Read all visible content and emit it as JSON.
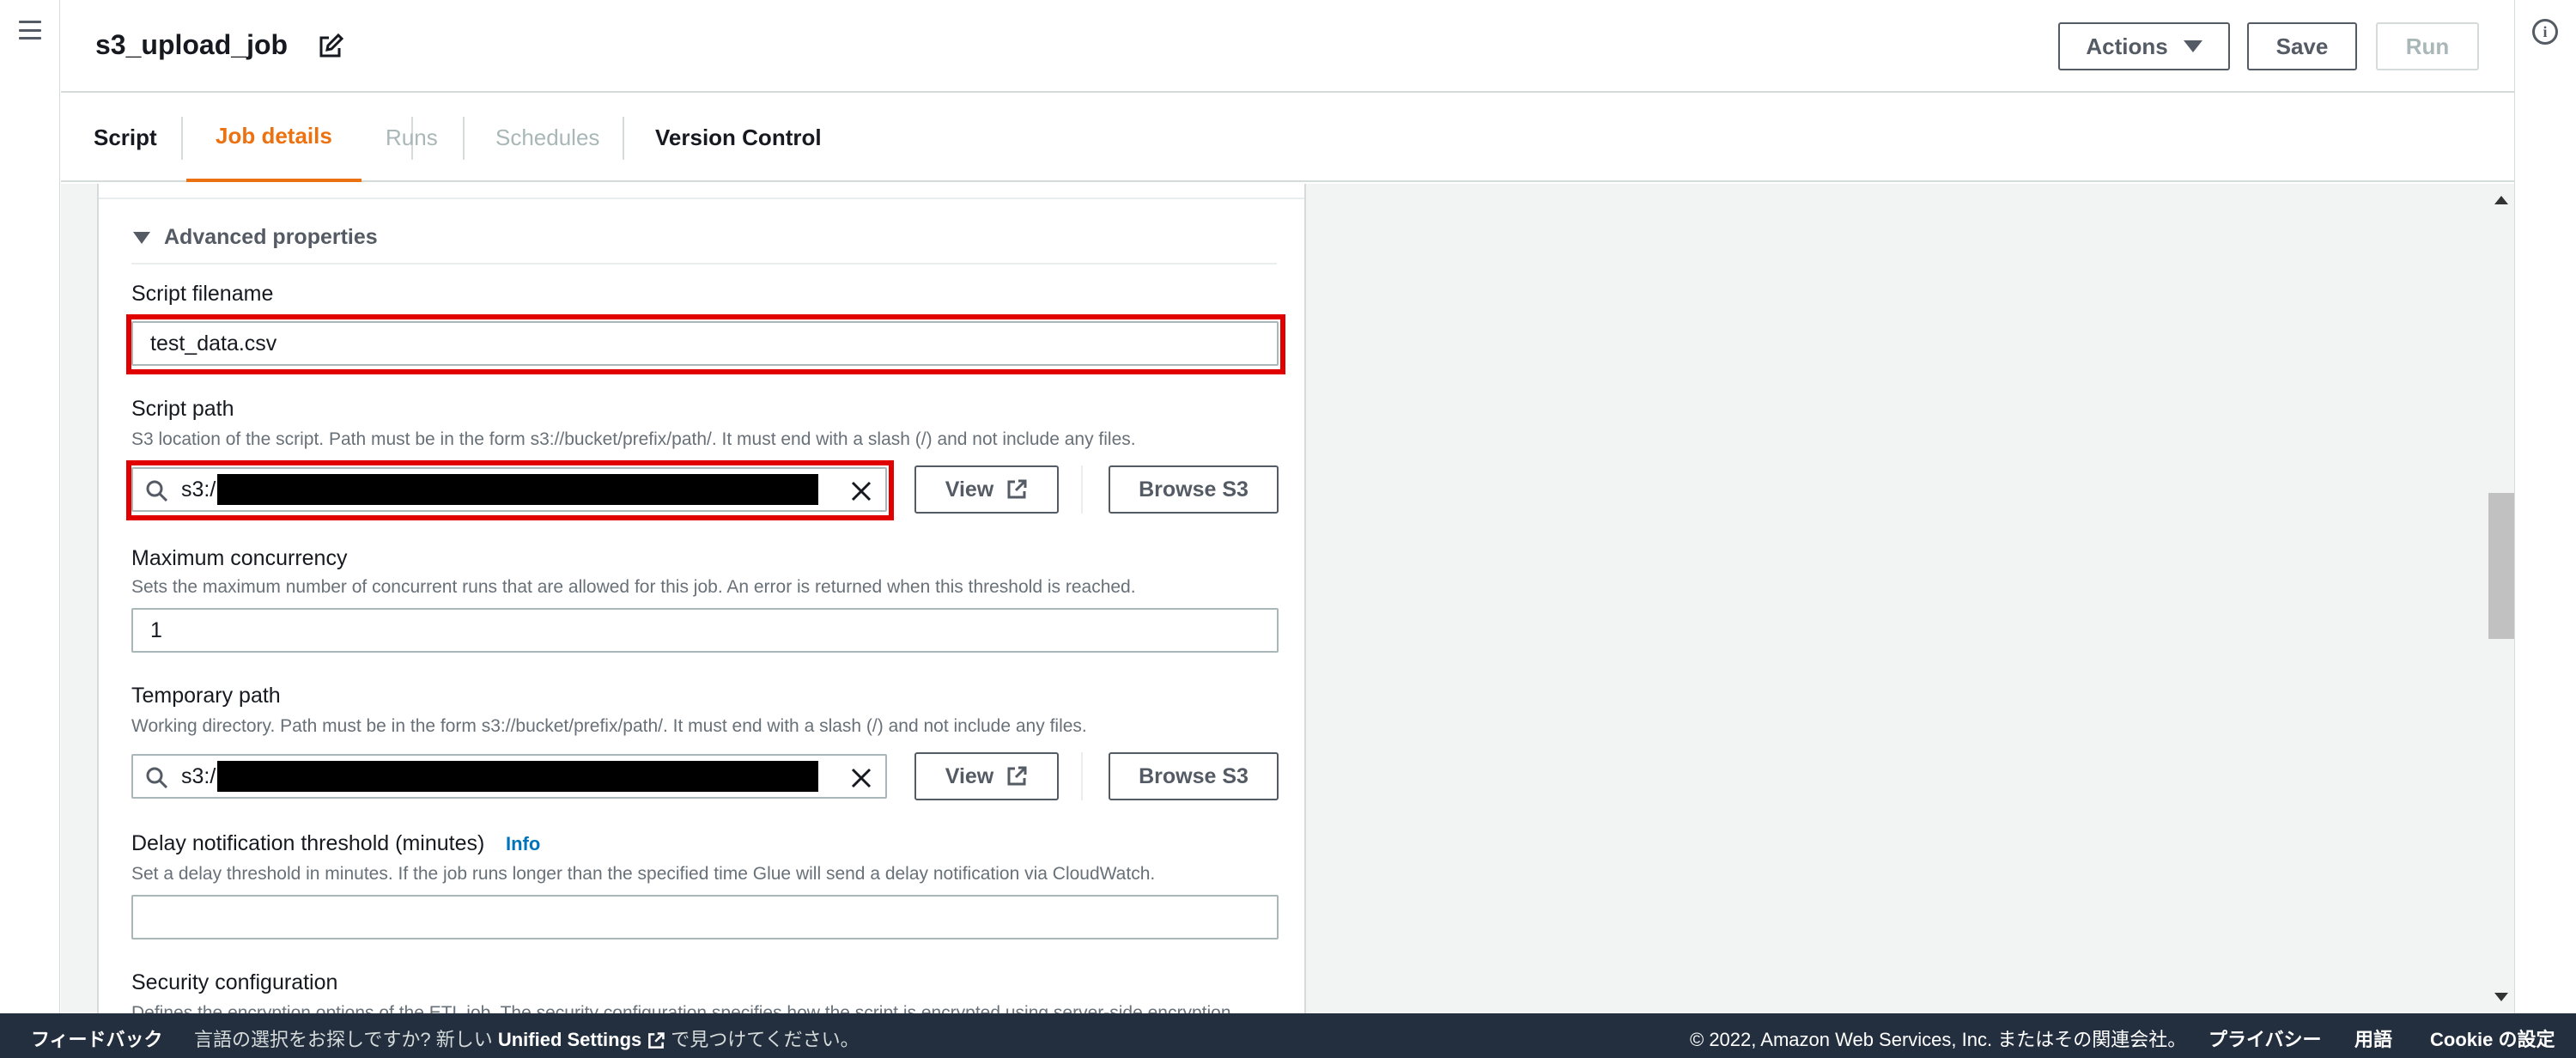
{
  "header": {
    "title": "s3_upload_job",
    "actions_label": "Actions",
    "save_label": "Save",
    "run_label": "Run"
  },
  "tabs": [
    {
      "label": "Script",
      "state": "normal"
    },
    {
      "label": "Job details",
      "state": "active"
    },
    {
      "label": "Runs",
      "state": "disabled"
    },
    {
      "label": "Schedules",
      "state": "disabled"
    },
    {
      "label": "Version Control",
      "state": "normal"
    }
  ],
  "advanced": {
    "header": "Advanced properties",
    "script_filename": {
      "label": "Script filename",
      "value": "test_data.csv"
    },
    "script_path": {
      "label": "Script path",
      "description": "S3 location of the script. Path must be in the form s3://bucket/prefix/path/. It must end with a slash (/) and not include any files.",
      "value": "s3:/",
      "view_label": "View",
      "browse_label": "Browse S3"
    },
    "max_concurrency": {
      "label": "Maximum concurrency",
      "description": "Sets the maximum number of concurrent runs that are allowed for this job. An error is returned when this threshold is reached.",
      "value": "1"
    },
    "temporary_path": {
      "label": "Temporary path",
      "description": "Working directory. Path must be in the form s3://bucket/prefix/path/. It must end with a slash (/) and not include any files.",
      "value": "s3:/",
      "view_label": "View",
      "browse_label": "Browse S3"
    },
    "delay_notification": {
      "label": "Delay notification threshold (minutes)",
      "info_label": "Info",
      "description": "Set a delay threshold in minutes. If the job runs longer than the specified time Glue will send a delay notification via CloudWatch.",
      "value": ""
    },
    "security_configuration": {
      "label": "Security configuration",
      "description_partial": "Defines the encryption options of the ETL job. The security configuration specifies how the script is encrypted using server-side encryption"
    }
  },
  "footer": {
    "feedback": "フィードバック",
    "lang_prompt": "言語の選択をお探しですか? 新しい",
    "unified_settings": "Unified Settings",
    "lang_suffix": "で見つけてください。",
    "copyright": "© 2022, Amazon Web Services, Inc. またはその関連会社。",
    "privacy": "プライバシー",
    "terms": "用語",
    "cookie": "Cookie の設定"
  },
  "colors": {
    "accent": "#ec7211",
    "highlight": "#e00000",
    "footer_bg": "#232f3e",
    "link": "#0073bb"
  }
}
